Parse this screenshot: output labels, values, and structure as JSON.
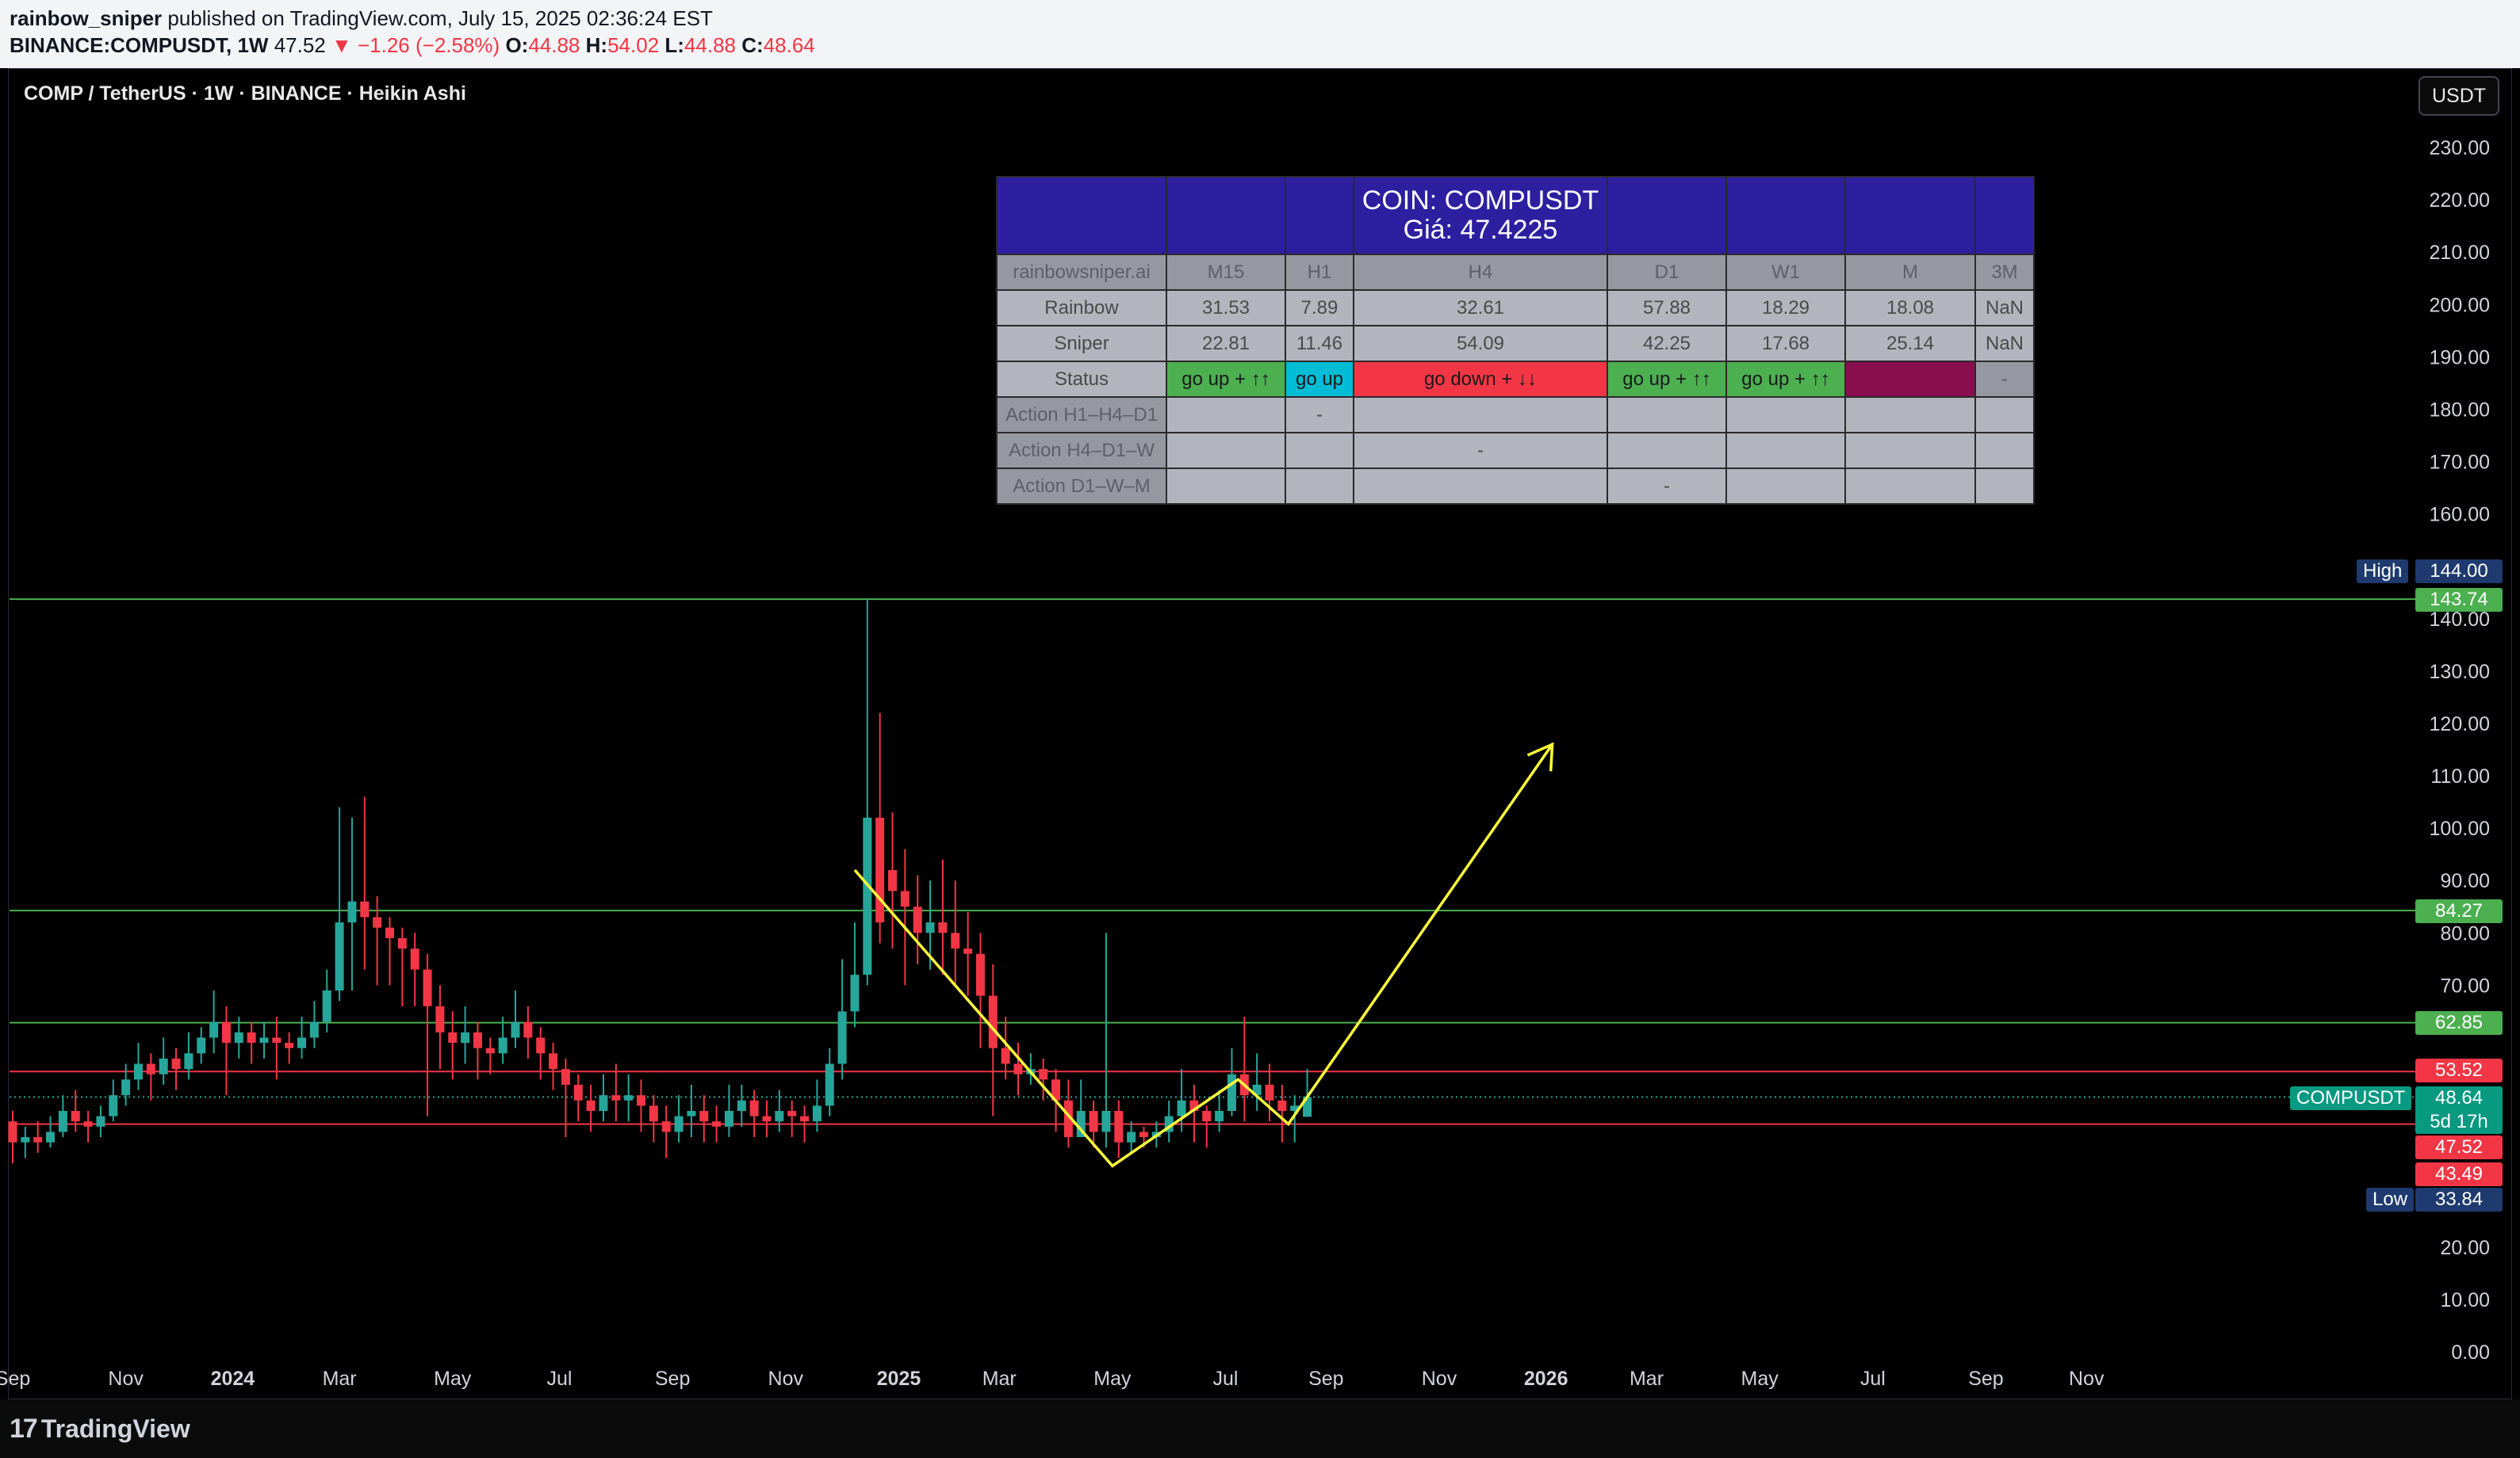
{
  "header": {
    "author": "rainbow_sniper",
    "published": "published on TradingView.com, July 15, 2025 02:36:24 EST",
    "symbol_line": "BINANCE:COMPUSDT, 1W",
    "price": "47.52",
    "change": "−1.26 (−2.58%)",
    "o_label": "O:",
    "o_val": "44.88",
    "h_label": "H:",
    "h_val": "54.02",
    "l_label": "L:",
    "l_val": "44.88",
    "c_label": "C:",
    "c_val": "48.64"
  },
  "chart_title": "COMP / TetherUS · 1W · BINANCE · Heikin Ashi",
  "currency_button": "USDT",
  "footer": {
    "logo": "TradingView"
  },
  "colors": {
    "up": "#26a69a",
    "down": "#f23645",
    "hline_green": "#4caf50",
    "hline_red": "#f23645",
    "arrow": "#ffff3b",
    "table_header": "#2d1fa0"
  },
  "table": {
    "title": "COIN: COMPUSDT",
    "price_line": "Giá: 47.4225",
    "header_row": [
      "rainbowsniper.ai",
      "M15",
      "H1",
      "H4",
      "D1",
      "W1",
      "M",
      "3M"
    ],
    "rows": [
      {
        "label": "Rainbow",
        "cells": [
          "31.53",
          "7.89",
          "32.61",
          "57.88",
          "18.29",
          "18.08",
          "NaN"
        ]
      },
      {
        "label": "Sniper",
        "cells": [
          "22.81",
          "11.46",
          "54.09",
          "42.25",
          "17.68",
          "25.14",
          "NaN"
        ]
      },
      {
        "label": "Status",
        "cells": [
          "go up + ↑↑",
          "go up",
          "go down + ↓↓",
          "go up + ↑↑",
          "go up + ↑↑",
          "",
          "-"
        ]
      },
      {
        "label": "Action H1–H4–D1",
        "cells": [
          "",
          "-",
          "",
          "",
          "",
          "",
          ""
        ]
      },
      {
        "label": "Action H4–D1–W",
        "cells": [
          "",
          "",
          "-",
          "",
          "",
          "",
          ""
        ]
      },
      {
        "label": "Action D1–W–M",
        "cells": [
          "",
          "",
          "",
          "-",
          "",
          "",
          ""
        ]
      }
    ]
  },
  "price_tags": {
    "high_label": "High",
    "high_val": "144.00",
    "g1": "143.74",
    "g2": "84.27",
    "g3": "62.85",
    "r1": "53.52",
    "symbol": "COMPUSDT",
    "current": "48.64",
    "countdown": "5d 17h",
    "r2": "47.52",
    "r3": "43.49",
    "low_label": "Low",
    "low_val": "33.84"
  },
  "chart_data": {
    "type": "candlestick",
    "title": "COMP / TetherUS · 1W · BINANCE · Heikin Ashi",
    "xlabel": "",
    "ylabel": "",
    "ylim": [
      0,
      235
    ],
    "y_ticks": [
      "230.00",
      "220.00",
      "210.00",
      "200.00",
      "190.00",
      "180.00",
      "170.00",
      "160.00",
      "140.00",
      "130.00",
      "120.00",
      "110.00",
      "100.00",
      "90.00",
      "80.00",
      "70.00",
      "20.00",
      "10.00",
      "0.00"
    ],
    "x_ticks": [
      {
        "label": "Sep",
        "week": 0,
        "bold": false
      },
      {
        "label": "Nov",
        "week": 9,
        "bold": false
      },
      {
        "label": "2024",
        "week": 17.5,
        "bold": true
      },
      {
        "label": "Mar",
        "week": 26,
        "bold": false
      },
      {
        "label": "May",
        "week": 35,
        "bold": false
      },
      {
        "label": "Jul",
        "week": 43.5,
        "bold": false
      },
      {
        "label": "Sep",
        "week": 52.5,
        "bold": false
      },
      {
        "label": "Nov",
        "week": 61.5,
        "bold": false
      },
      {
        "label": "2025",
        "week": 70.5,
        "bold": true
      },
      {
        "label": "Mar",
        "week": 78.5,
        "bold": false
      },
      {
        "label": "May",
        "week": 87.5,
        "bold": false
      },
      {
        "label": "Jul",
        "week": 96.5,
        "bold": false
      },
      {
        "label": "Sep",
        "week": 104.5,
        "bold": false
      },
      {
        "label": "Nov",
        "week": 113.5,
        "bold": false
      },
      {
        "label": "2026",
        "week": 122,
        "bold": true
      },
      {
        "label": "Mar",
        "week": 130,
        "bold": false
      },
      {
        "label": "May",
        "week": 139,
        "bold": false
      },
      {
        "label": "Jul",
        "week": 148,
        "bold": false
      },
      {
        "label": "Sep",
        "week": 157,
        "bold": false
      },
      {
        "label": "Nov",
        "week": 165,
        "bold": false
      }
    ],
    "horizontal_lines": [
      {
        "value": 143.74,
        "color": "green"
      },
      {
        "value": 84.27,
        "color": "green"
      },
      {
        "value": 62.85,
        "color": "green"
      },
      {
        "value": 53.52,
        "color": "red"
      },
      {
        "value": 43.49,
        "color": "red"
      }
    ],
    "current_price_line": 48.64,
    "projection_path": [
      [
        67,
        92
      ],
      [
        87.5,
        35.5
      ],
      [
        97.5,
        52
      ],
      [
        101.5,
        43.5
      ],
      [
        122.5,
        116
      ]
    ],
    "candles": [
      [
        0,
        44,
        40,
        46,
        36
      ],
      [
        1,
        40,
        41,
        43,
        37
      ],
      [
        2,
        41,
        40,
        44,
        38
      ],
      [
        3,
        40,
        42,
        45,
        39
      ],
      [
        4,
        42,
        46,
        49,
        41
      ],
      [
        5,
        46,
        44,
        50,
        42
      ],
      [
        6,
        44,
        43,
        46,
        40
      ],
      [
        7,
        43,
        45,
        47,
        41
      ],
      [
        8,
        45,
        49,
        52,
        44
      ],
      [
        9,
        49,
        52,
        55,
        47
      ],
      [
        10,
        52,
        55,
        59,
        50
      ],
      [
        11,
        55,
        53,
        57,
        48
      ],
      [
        12,
        53,
        56,
        60,
        51
      ],
      [
        13,
        56,
        54,
        58,
        50
      ],
      [
        14,
        54,
        57,
        61,
        52
      ],
      [
        15,
        57,
        60,
        62,
        55
      ],
      [
        16,
        60,
        63,
        69,
        57
      ],
      [
        17,
        63,
        59,
        66,
        49
      ],
      [
        18,
        59,
        61,
        64,
        56
      ],
      [
        19,
        61,
        59,
        63,
        55
      ],
      [
        20,
        59,
        60,
        63,
        56
      ],
      [
        21,
        60,
        59,
        64,
        52
      ],
      [
        22,
        59,
        58,
        61,
        55
      ],
      [
        23,
        58,
        60,
        64,
        56
      ],
      [
        24,
        60,
        63,
        67,
        58
      ],
      [
        25,
        63,
        69,
        73,
        61
      ],
      [
        26,
        69,
        82,
        104,
        67
      ],
      [
        27,
        82,
        86,
        102,
        69
      ],
      [
        28,
        86,
        83,
        106,
        73
      ],
      [
        29,
        83,
        81,
        87,
        70
      ],
      [
        30,
        81,
        79,
        83,
        70
      ],
      [
        31,
        79,
        77,
        81,
        66
      ],
      [
        32,
        77,
        73,
        80,
        66
      ],
      [
        33,
        73,
        66,
        76,
        45
      ],
      [
        34,
        66,
        61,
        70,
        54
      ],
      [
        35,
        61,
        59,
        65,
        52
      ],
      [
        36,
        59,
        61,
        66,
        55
      ],
      [
        37,
        61,
        58,
        63,
        52
      ],
      [
        38,
        58,
        57,
        60,
        53
      ],
      [
        39,
        57,
        60,
        64,
        55
      ],
      [
        40,
        60,
        63,
        69,
        58
      ],
      [
        41,
        63,
        60,
        66,
        56
      ],
      [
        42,
        60,
        57,
        62,
        52
      ],
      [
        43,
        57,
        54,
        59,
        50
      ],
      [
        44,
        54,
        51,
        56,
        41
      ],
      [
        45,
        51,
        48,
        53,
        44
      ],
      [
        46,
        48,
        46,
        51,
        42
      ],
      [
        47,
        46,
        49,
        53,
        44
      ],
      [
        48,
        49,
        48,
        55,
        44
      ],
      [
        49,
        48,
        49,
        53,
        44
      ],
      [
        50,
        49,
        47,
        52,
        42
      ],
      [
        51,
        47,
        44,
        49,
        40
      ],
      [
        52,
        44,
        42,
        47,
        37
      ],
      [
        53,
        42,
        45,
        49,
        40
      ],
      [
        54,
        45,
        46,
        51,
        41
      ],
      [
        55,
        46,
        44,
        49,
        40
      ],
      [
        56,
        44,
        43,
        47,
        40
      ],
      [
        57,
        43,
        46,
        51,
        41
      ],
      [
        58,
        46,
        48,
        51,
        43
      ],
      [
        59,
        48,
        45,
        50,
        41
      ],
      [
        60,
        45,
        44,
        48,
        41
      ],
      [
        61,
        44,
        46,
        50,
        42
      ],
      [
        62,
        46,
        45,
        48,
        41
      ],
      [
        63,
        45,
        44,
        47,
        40
      ],
      [
        64,
        44,
        47,
        52,
        42
      ],
      [
        65,
        47,
        55,
        58,
        45
      ],
      [
        66,
        55,
        65,
        75,
        52
      ],
      [
        67,
        65,
        72,
        82,
        62
      ],
      [
        68,
        72,
        102,
        143.7,
        70
      ],
      [
        69,
        102,
        82,
        122,
        78
      ],
      [
        70,
        92,
        88,
        103,
        77
      ],
      [
        71,
        88,
        85,
        96,
        70
      ],
      [
        72,
        85,
        80,
        91,
        74
      ],
      [
        73,
        80,
        82,
        90,
        73
      ],
      [
        74,
        82,
        80,
        94,
        72
      ],
      [
        75,
        80,
        77,
        90,
        70
      ],
      [
        76,
        77,
        76,
        84,
        68
      ],
      [
        77,
        76,
        68,
        80,
        58
      ],
      [
        78,
        68,
        58,
        74,
        45
      ],
      [
        79,
        58,
        55,
        64,
        52
      ],
      [
        80,
        55,
        53,
        59,
        49
      ],
      [
        81,
        53,
        54,
        57,
        51
      ],
      [
        82,
        54,
        52,
        56,
        48
      ],
      [
        83,
        52,
        48,
        54,
        42
      ],
      [
        84,
        48,
        41,
        52,
        39
      ],
      [
        85,
        41,
        46,
        52,
        43
      ],
      [
        86,
        46,
        42,
        48,
        39
      ],
      [
        87,
        42,
        46,
        80,
        39
      ],
      [
        88,
        46,
        40,
        48,
        37
      ],
      [
        89,
        40,
        42,
        44,
        38
      ],
      [
        90,
        42,
        41,
        43,
        39
      ],
      [
        91,
        41,
        42,
        44,
        39
      ],
      [
        92,
        42,
        45,
        48,
        40
      ],
      [
        93,
        45,
        48,
        54,
        42
      ],
      [
        94,
        48,
        46,
        51,
        40
      ],
      [
        95,
        46,
        44,
        47,
        39
      ],
      [
        96,
        44,
        46,
        50,
        42
      ],
      [
        97,
        46,
        53,
        58,
        45
      ],
      [
        98,
        53,
        49,
        64,
        44
      ],
      [
        99,
        49,
        51,
        57,
        46
      ],
      [
        100,
        51,
        48,
        55,
        44
      ],
      [
        101,
        48,
        46,
        51,
        40
      ],
      [
        102,
        46,
        47,
        49,
        40
      ],
      [
        103,
        44.88,
        48.64,
        54.02,
        44.88
      ]
    ]
  }
}
